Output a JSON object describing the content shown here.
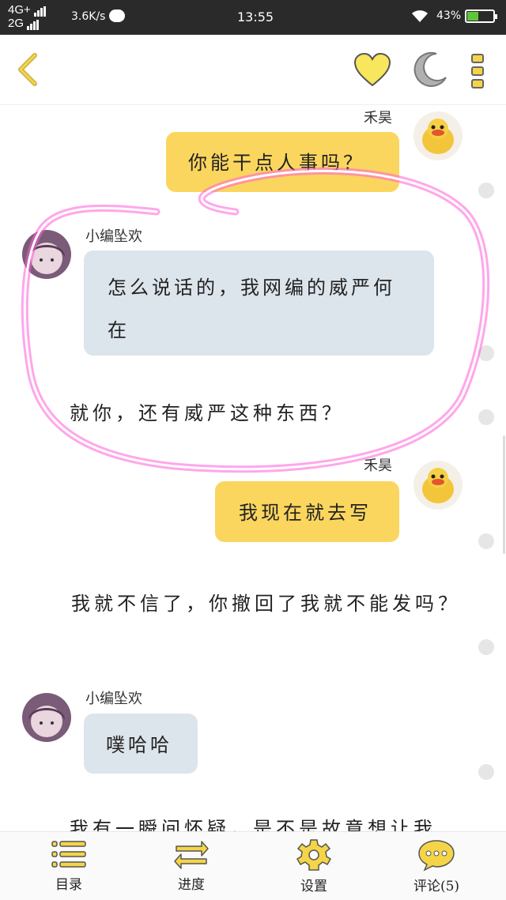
{
  "status_bar": {
    "network_top": "4G+",
    "network_bottom": "2G",
    "speed": "3.6K/s",
    "time": "13:55",
    "battery": "43%",
    "battery_level": 0.43
  },
  "top_bar": {
    "back_icon": "chevron-left-icon",
    "favorite_icon": "heart-icon",
    "night_mode_icon": "moon-icon",
    "more_icon": "more-vertical-icon"
  },
  "messages": [
    {
      "speaker": "禾昊",
      "text": "你能干点人事吗？",
      "side": "right"
    },
    {
      "speaker": "小编坠欢",
      "text": "怎么说话的，我网编的威严何在",
      "side": "left"
    },
    {
      "narration": "就你，还有威严这种东西？"
    },
    {
      "speaker": "禾昊",
      "text": "我现在就去写",
      "side": "right"
    },
    {
      "narration": "我就不信了，你撤回了我就不能发吗？"
    },
    {
      "speaker": "小编坠欢",
      "text": "噗哈哈",
      "side": "left"
    },
    {
      "narration": "我有一瞬间怀疑，是不是故意想让我"
    }
  ],
  "bottom_bar": [
    {
      "label": "目录",
      "icon": "list-icon"
    },
    {
      "label": "进度",
      "icon": "arrows-icon"
    },
    {
      "label": "设置",
      "icon": "gear-icon"
    },
    {
      "label": "评论(5)",
      "icon": "comment-icon"
    }
  ],
  "colors": {
    "accent": "#f5d547",
    "bubble_me": "#fbd65e",
    "bubble_other": "#dde5ec",
    "highlight_circle": "#ff5fd8"
  }
}
